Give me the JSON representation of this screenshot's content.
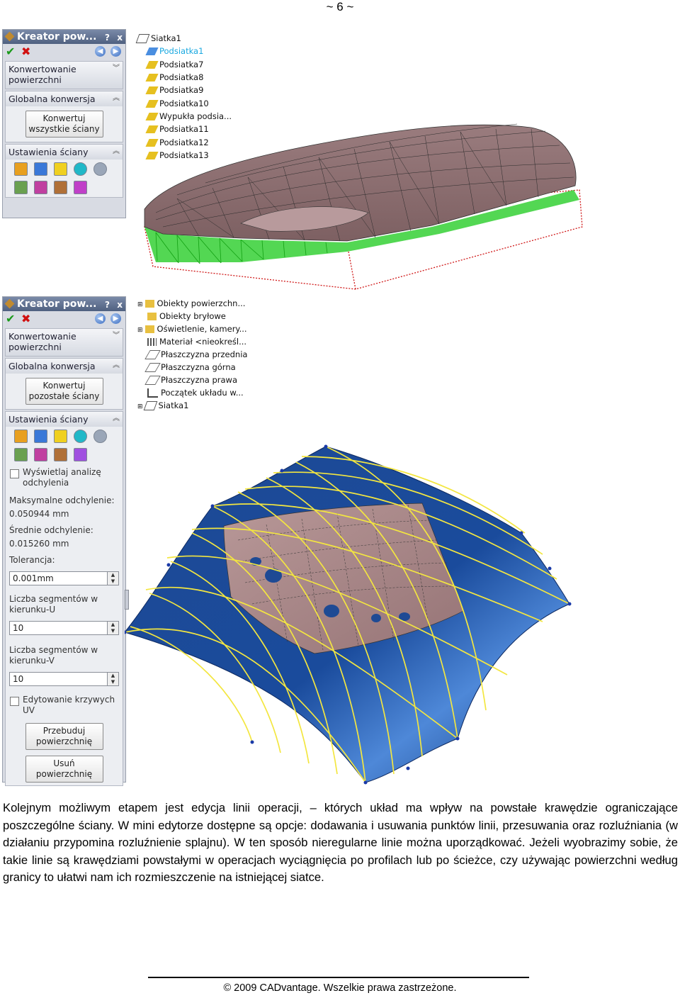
{
  "page_number": "~ 6 ~",
  "panel1": {
    "title": "Kreator pow...",
    "help": "?",
    "close": "x",
    "sections": {
      "konwersja": "Konwertowanie powierzchni",
      "globalna": "Globalna konwersja",
      "ustawienia": "Ustawienia ściany"
    },
    "convert_button": "Konwertuj wszystkie ściany"
  },
  "tree1": {
    "items": [
      "Siatka1",
      "Podsiatka1",
      "Podsiatka7",
      "Podsiatka8",
      "Podsiatka9",
      "Podsiatka10",
      "Wypukła podsia...",
      "Podsiatka11",
      "Podsiatka12",
      "Podsiatka13"
    ]
  },
  "panel2": {
    "title": "Kreator pow...",
    "help": "?",
    "close": "x",
    "sections": {
      "konwersja": "Konwertowanie powierzchni",
      "globalna": "Globalna konwersja",
      "ustawienia": "Ustawienia ściany"
    },
    "convert_button": "Konwertuj pozostałe ściany",
    "show_analysis": "Wyświetlaj analizę odchylenia",
    "max_dev_label": "Maksymalne odchylenie:",
    "max_dev_value": "0.050944  mm",
    "avg_dev_label": "Średnie odchylenie:",
    "avg_dev_value": "0.015260  mm",
    "tolerance_label": "Tolerancja:",
    "tolerance_value": "0.001mm",
    "segments_u_label": "Liczba segmentów w kierunku-U",
    "segments_u_value": "10",
    "segments_v_label": "Liczba segmentów w kierunku-V",
    "segments_v_value": "10",
    "edit_uv": "Edytowanie krzywych UV",
    "rebuild_button": "Przebuduj powierzchnię",
    "delete_button": "Usuń powierzchnię"
  },
  "tree2": {
    "items": [
      "Obiekty powierzchn...",
      "Obiekty bryłowe",
      "Oświetlenie, kamery...",
      "Materiał <nieokreśl...",
      "Płaszczyzna przednia",
      "Płaszczyzna górna",
      "Płaszczyzna prawa",
      "Początek układu w...",
      "Siatka1"
    ]
  },
  "body_text": "Kolejnym możliwym etapem jest edycja linii operacji, – których układ ma wpływ na powstałe krawędzie ograniczające poszczególne ściany. W mini edytorze dostępne są opcje: dodawania i usuwania punktów linii, przesuwania oraz rozluźniania (w działaniu przypomina rozluźnienie splajnu). W ten sposób nieregularne linie można uporządkować. Jeżeli wyobrazimy sobie, że takie linie są krawędziami powstałymi w operacjach wyciągnięcia po profilach lub po ścieżce, czy używając powierzchni według granicy to ułatwi nam ich rozmieszczenie na istniejącej siatce.",
  "footer": "© 2009 CADvantage. Wszelkie prawa zastrzeżone.",
  "colors": {
    "mesh_brown": "#8a6a6c",
    "mesh_green": "#22e022",
    "surface_blue": "#1f4f99",
    "grid_yellow": "#f3e640",
    "selection_cyan": "#18a8e0"
  }
}
